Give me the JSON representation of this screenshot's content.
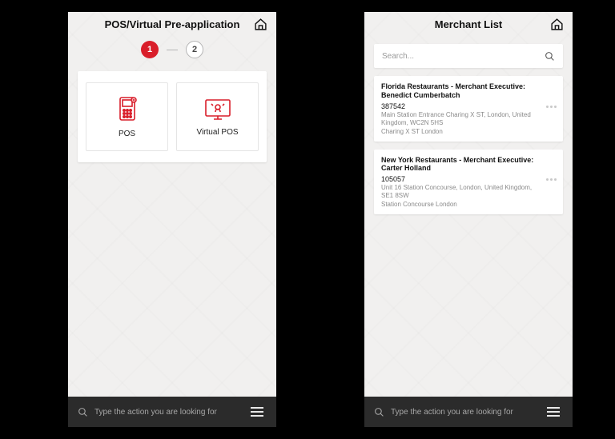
{
  "left": {
    "title": "POS/Virtual Pre-application",
    "steps": {
      "s1": "1",
      "s2": "2"
    },
    "options": {
      "pos": "POS",
      "vpos": "Virtual POS"
    }
  },
  "right": {
    "title": "Merchant List",
    "search_placeholder": "Search...",
    "items": [
      {
        "title": "Florida Restaurants - Merchant Executive: Benedict Cumberbatch",
        "id": "387542",
        "addr": "Main Station Entrance Charing X ST, London, United Kingdom, WC2N 5HS",
        "branch": "Charing X ST London"
      },
      {
        "title": "New York Restaurants - Merchant Executive: Carter Holland",
        "id": "105057",
        "addr": "Unit 16 Station Concourse, London, United Kingdom, SE1 8SW",
        "branch": "Station Concourse London"
      }
    ]
  },
  "bottombar": {
    "placeholder": "Type the action you are looking for"
  }
}
